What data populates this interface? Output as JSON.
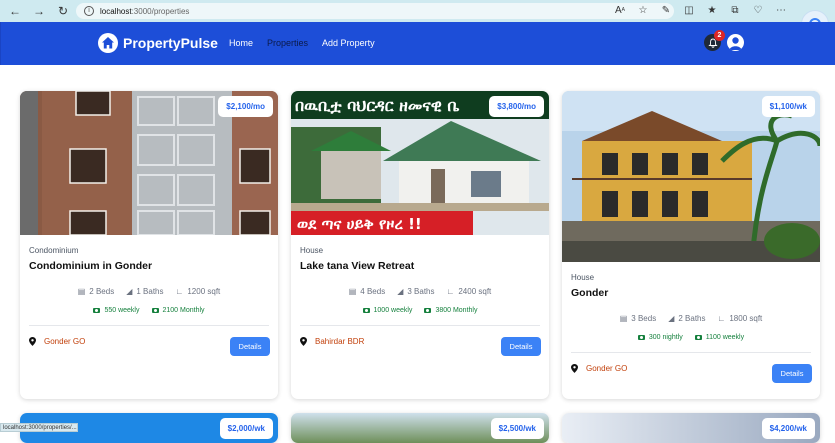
{
  "browser": {
    "url_host": "localhost",
    "url_path": ":3000/properties",
    "status_url": "localhost:3000/properties/..."
  },
  "header": {
    "brand": "PropertyPulse",
    "nav": [
      "Home",
      "Properties",
      "Add Property"
    ],
    "notification_count": "2",
    "colors": {
      "bar": "#1d4ed8",
      "accent": "#2563eb",
      "button": "#3b82f6",
      "location": "#c2410c",
      "rate": "#15803d"
    }
  },
  "cards": [
    {
      "price": "$2,100/mo",
      "type": "Condominium",
      "name": "Condominium in Gonder",
      "beds": "2 Beds",
      "baths": "1 Baths",
      "sqft": "1200 sqft",
      "rate_a": "550 weekly",
      "rate_b": "2100 Monthly",
      "location": "Gonder GO",
      "details": "Details"
    },
    {
      "price": "$3,800/mo",
      "type": "House",
      "name": "Lake tana View Retreat",
      "beds": "4 Beds",
      "baths": "3 Baths",
      "sqft": "2400 sqft",
      "rate_a": "1000 weekly",
      "rate_b": "3800 Monthly",
      "location": "Bahirdar BDR",
      "details": "Details",
      "banner_top": "በዉቢቷ ባህርዳር ዘመናዊ ቤ",
      "banner_bottom": "ወደ ጣና ሀይቅ የዞረ !!"
    },
    {
      "price": "$1,100/wk",
      "type": "House",
      "name": "Gonder",
      "beds": "3 Beds",
      "baths": "2 Baths",
      "sqft": "1800 sqft",
      "rate_a": "300 nightly",
      "rate_b": "1100 weekly",
      "location": "Gonder GO",
      "details": "Details"
    }
  ],
  "next_row_prices": [
    "$2,000/wk",
    "$2,500/wk",
    "$4,200/wk"
  ]
}
